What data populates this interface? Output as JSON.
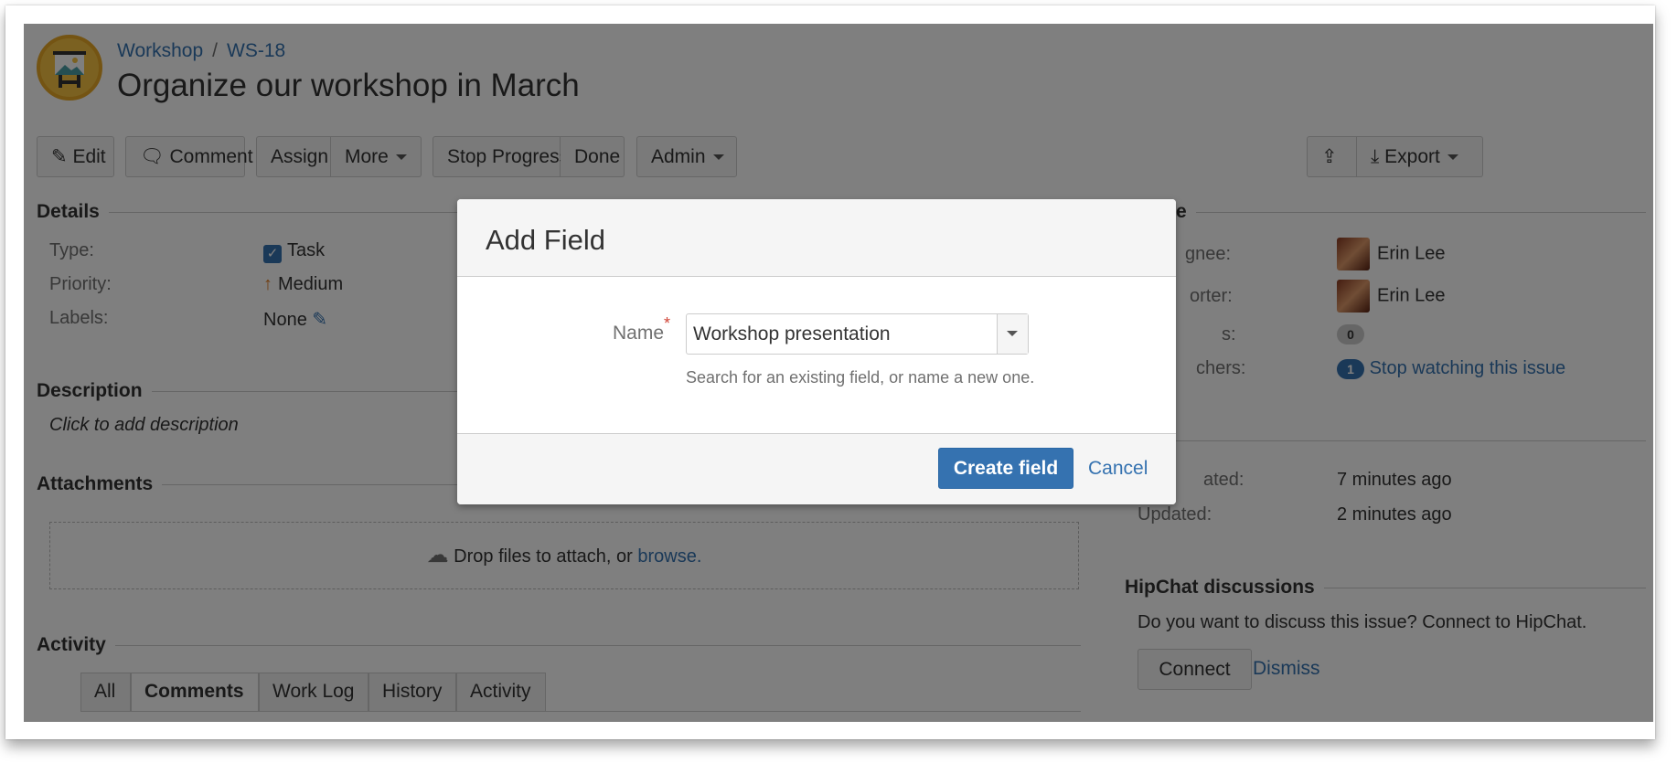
{
  "breadcrumbs": {
    "project": "Workshop",
    "issue_key": "WS-18",
    "separator": "/"
  },
  "issue": {
    "title": "Organize our workshop in March"
  },
  "toolbar": {
    "edit": "Edit",
    "comment": "Comment",
    "assign": "Assign",
    "more": "More",
    "stop_progress": "Stop Progress",
    "done": "Done",
    "admin": "Admin",
    "export": "Export"
  },
  "details": {
    "heading": "Details",
    "type_label": "Type:",
    "type_value": "Task",
    "priority_label": "Priority:",
    "priority_value": "Medium",
    "labels_label": "Labels:",
    "labels_value": "None"
  },
  "description": {
    "heading": "Description",
    "placeholder": "Click to add description"
  },
  "attachments": {
    "heading": "Attachments",
    "drop_text": "Drop files to attach, or",
    "browse": "browse."
  },
  "activity": {
    "heading": "Activity",
    "tabs": [
      "All",
      "Comments",
      "Work Log",
      "History",
      "Activity"
    ],
    "active_tab": "Comments"
  },
  "people": {
    "heading": "e",
    "assignee_label": "gnee:",
    "assignee": "Erin Lee",
    "reporter_label": "orter:",
    "reporter": "Erin Lee",
    "votes_label": "s:",
    "votes": "0",
    "watchers_label": "chers:",
    "watchers": "1",
    "watch_link": "Stop watching this issue"
  },
  "dates": {
    "created_label": "ated:",
    "created": "7 minutes ago",
    "updated_label": "Updated:",
    "updated": "2 minutes ago"
  },
  "hipchat": {
    "heading": "HipChat discussions",
    "text": "Do you want to discuss this issue? Connect to HipChat.",
    "connect": "Connect",
    "dismiss": "Dismiss"
  },
  "dialog": {
    "title": "Add Field",
    "name_label": "Name",
    "required_mark": "*",
    "name_value": "Workshop presentation",
    "hint": "Search for an existing field, or name a new one.",
    "create": "Create field",
    "cancel": "Cancel"
  },
  "colors": {
    "link": "#3572b0",
    "primary": "#3572b0",
    "required": "#d04437",
    "project_avatar": "#f6c342"
  }
}
